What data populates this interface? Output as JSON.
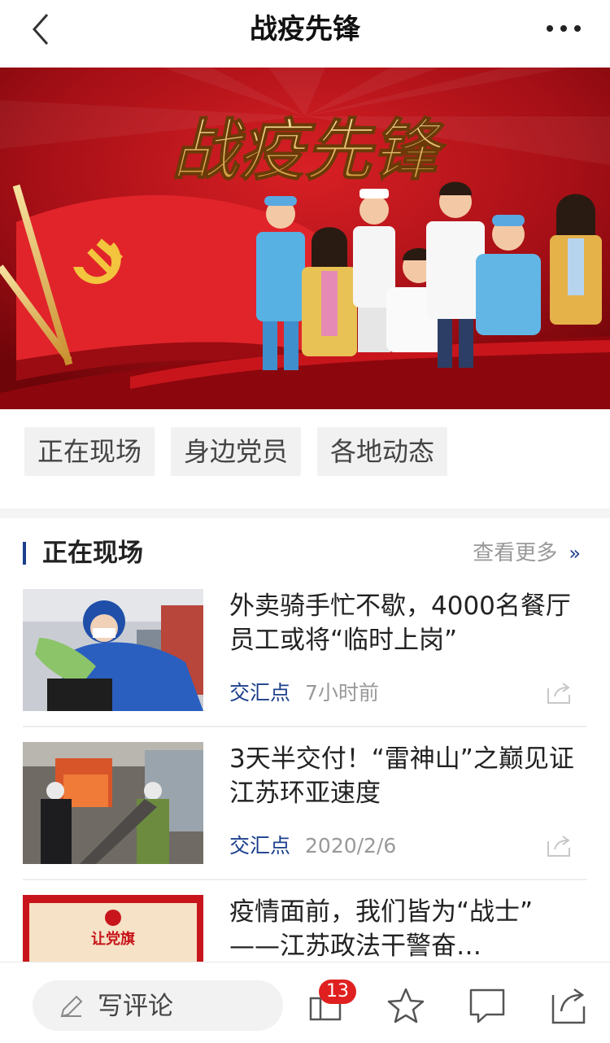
{
  "header": {
    "title": "战疫先锋",
    "back_icon": "chevron-left-icon",
    "more_icon": "more-dots-icon"
  },
  "banner": {
    "heading": "战疫先锋"
  },
  "tabs": [
    {
      "label": "正在现场"
    },
    {
      "label": "身边党员"
    },
    {
      "label": "各地动态"
    }
  ],
  "section": {
    "title": "正在现场",
    "more_label": "查看更多",
    "more_icon": "double-chevron-right-icon"
  },
  "news": [
    {
      "headline": "外卖骑手忙不歇，4000名餐厅员工或将“临时上岗”",
      "source": "交汇点",
      "time": "7小时前"
    },
    {
      "headline": "3天半交付！“雷神山”之巅见证江苏环亚速度",
      "source": "交汇点",
      "time": "2020/2/6"
    },
    {
      "headline": "疫情面前，我们皆为“战士” ——江苏政法干警奋…",
      "thumb_caption": "让党旗"
    }
  ],
  "bottom_bar": {
    "comment_label": "写评论",
    "comment_count": "13",
    "icons": [
      "pen-icon",
      "comments-icon",
      "star-icon",
      "comment-bubble-icon",
      "share-icon"
    ]
  },
  "colors": {
    "brand_blue": "#1b3f8c",
    "badge_red": "#e02020",
    "banner_red": "#b3121a",
    "gold": "#e7c35a"
  }
}
